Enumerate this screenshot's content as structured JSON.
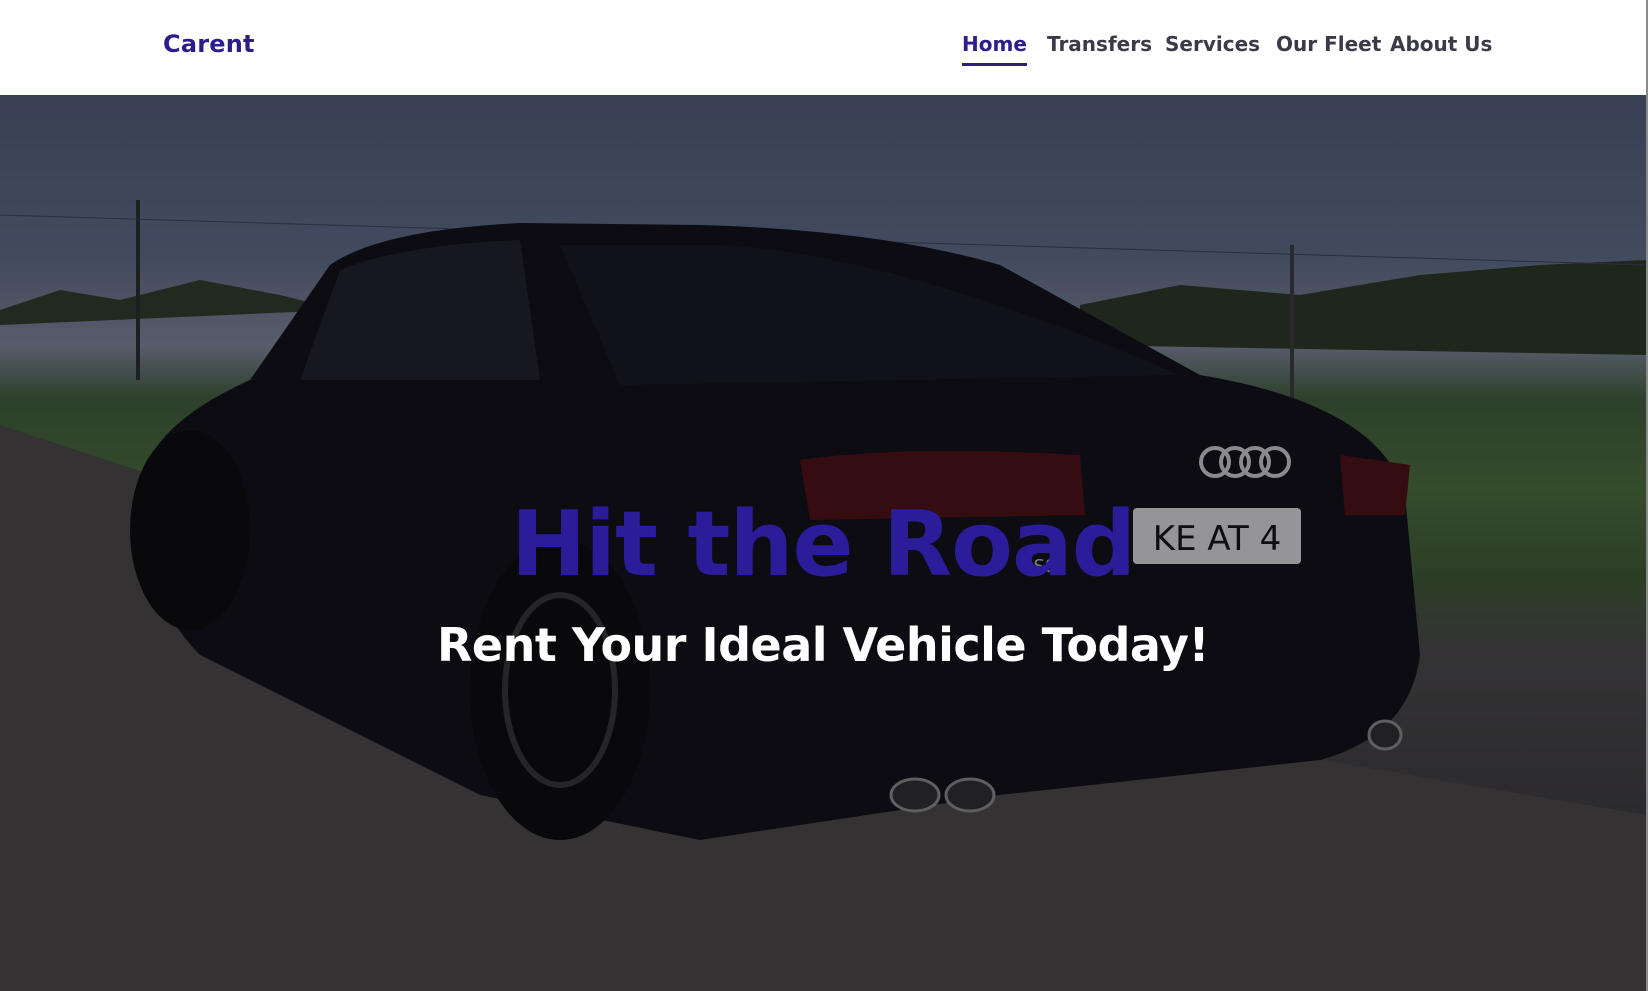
{
  "navbar": {
    "brand": "Carent",
    "links": [
      {
        "label": "Home",
        "active": true
      },
      {
        "label": "Transfers",
        "active": false
      },
      {
        "label": "Services",
        "active": false
      },
      {
        "label": "Our Fleet",
        "active": false
      },
      {
        "label": "About Us",
        "active": false
      }
    ]
  },
  "hero": {
    "title": "Hit the Road",
    "subtitle": "Rent Your Ideal Vehicle Today!",
    "image": {
      "subject": "black sedan driving on a road",
      "license_plate": "KE AT 4",
      "badge": "S8"
    }
  },
  "colors": {
    "brand": "#2b1d8a",
    "nav_text": "#3a3a48",
    "hero_title": "#2b1d9a",
    "hero_subtitle": "#ffffff"
  }
}
